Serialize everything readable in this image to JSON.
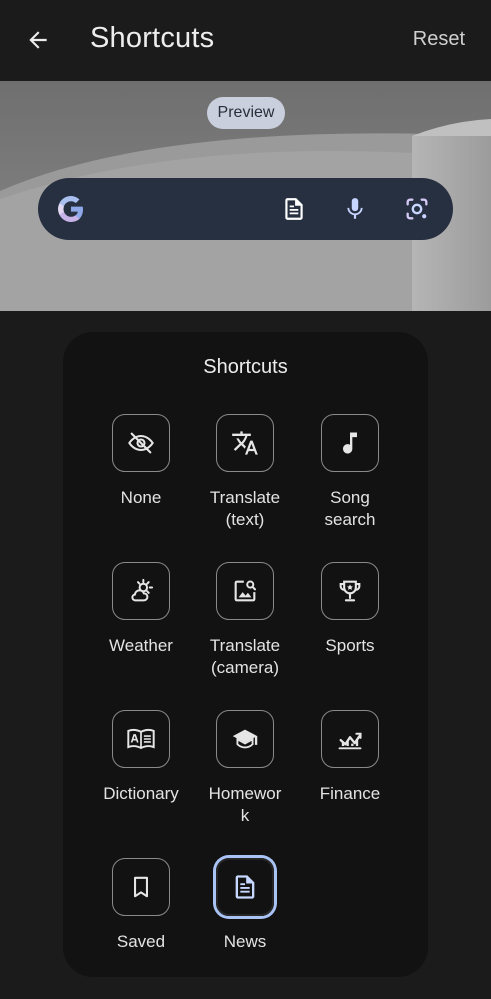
{
  "appbar": {
    "title": "Shortcuts",
    "reset_label": "Reset"
  },
  "preview": {
    "pill_label": "Preview"
  },
  "panel": {
    "title": "Shortcuts",
    "items": [
      {
        "label": "None",
        "icon": "eye-off-icon",
        "selected": false
      },
      {
        "label": "Translate\n(text)",
        "icon": "translate-icon",
        "selected": false
      },
      {
        "label": "Song\nsearch",
        "icon": "music-note-icon",
        "selected": false
      },
      {
        "label": "Weather",
        "icon": "weather-icon",
        "selected": false
      },
      {
        "label": "Translate\n(camera)",
        "icon": "image-search-icon",
        "selected": false
      },
      {
        "label": "Sports",
        "icon": "trophy-icon",
        "selected": false
      },
      {
        "label": "Dictionary",
        "icon": "dictionary-icon",
        "selected": false
      },
      {
        "label": "Homewor\nk",
        "icon": "graduation-cap-icon",
        "selected": false
      },
      {
        "label": "Finance",
        "icon": "finance-chart-icon",
        "selected": false
      },
      {
        "label": "Saved",
        "icon": "bookmark-icon",
        "selected": false
      },
      {
        "label": "News",
        "icon": "news-article-icon",
        "selected": true
      }
    ]
  },
  "colors": {
    "searchbar_bg": "#273040",
    "selected_ring": "#a9c3f5",
    "pill_bg": "#c9cfdd"
  }
}
